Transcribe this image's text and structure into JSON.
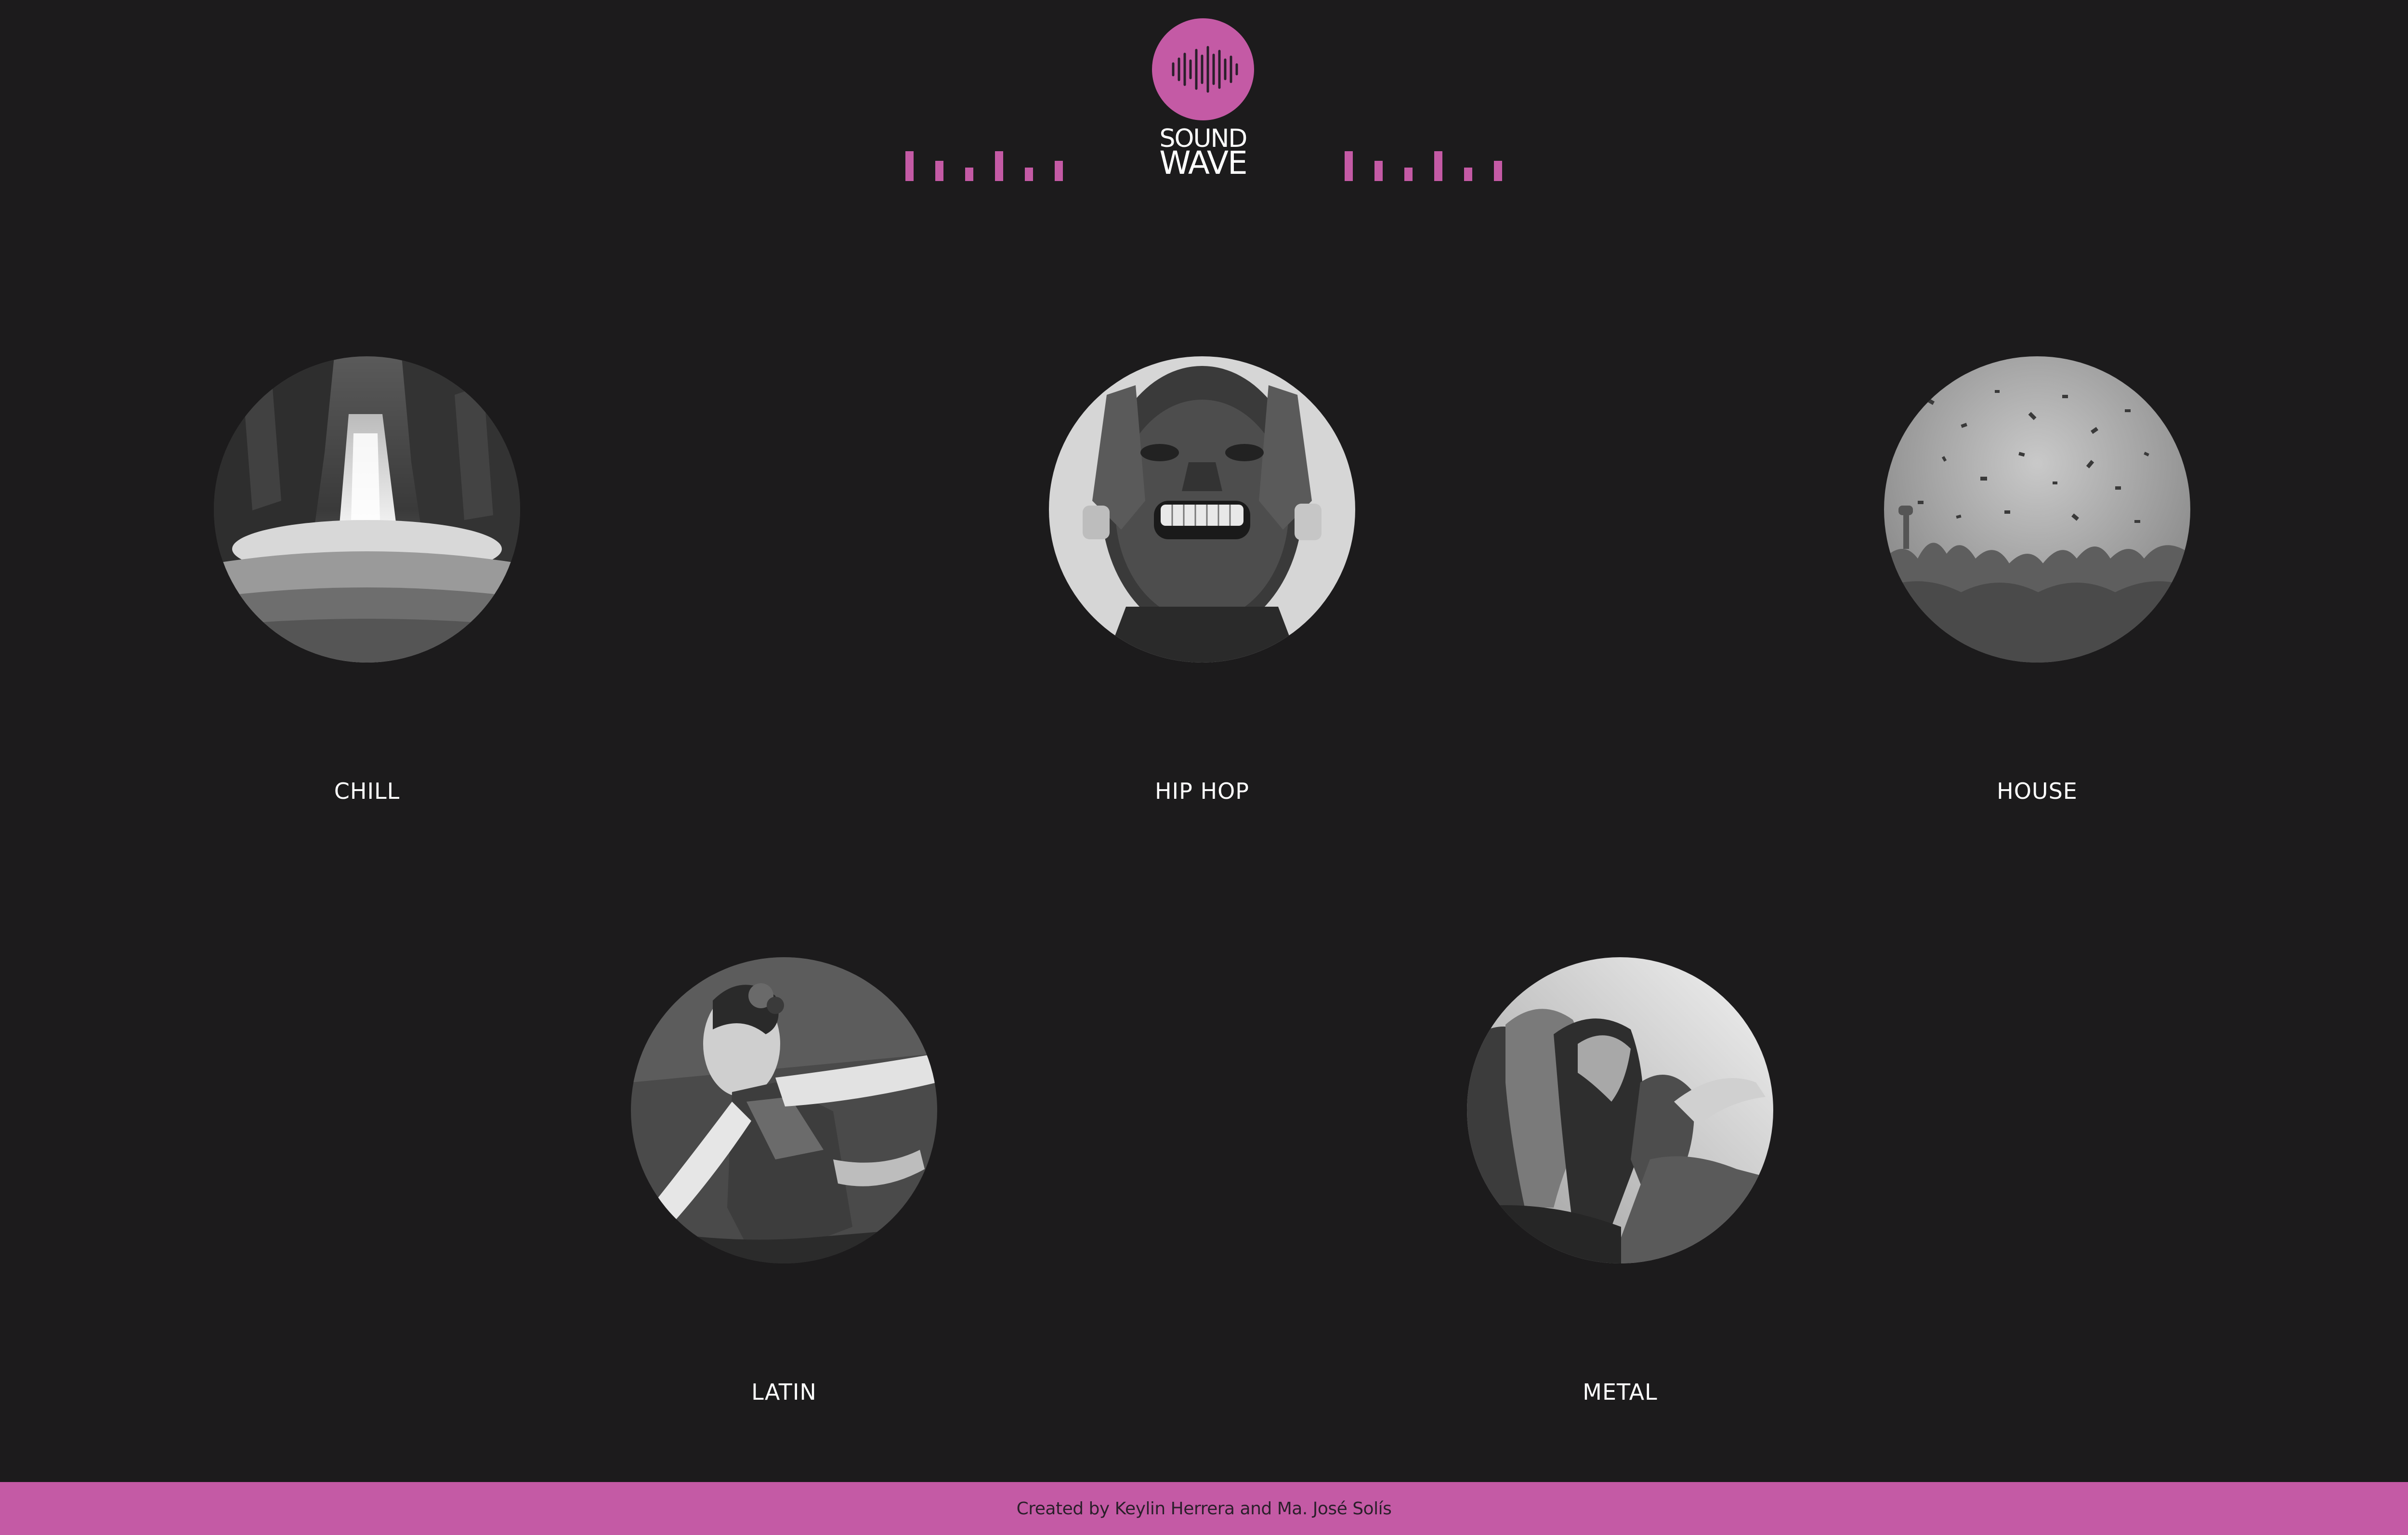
{
  "brand": {
    "line1": "SOUND",
    "line2": "WAVE",
    "accent_color": "#c45aa5",
    "logo_icon": "soundwave-icon"
  },
  "genres": [
    {
      "label": "CHILL",
      "image": "waterfall-photo"
    },
    {
      "label": "HIP HOP",
      "image": "grillz-portrait-photo"
    },
    {
      "label": "HOUSE",
      "image": "confetti-crowd-photo"
    },
    {
      "label": "LATIN",
      "image": "dancer-painting"
    },
    {
      "label": "METAL",
      "image": "headbanging-crowd-photo"
    }
  ],
  "footer": {
    "credit": "Created by Keylin Herrera and Ma. José Solís"
  },
  "colors": {
    "background": "#1c1b1c",
    "accent": "#c45aa5",
    "text": "#ffffff"
  }
}
